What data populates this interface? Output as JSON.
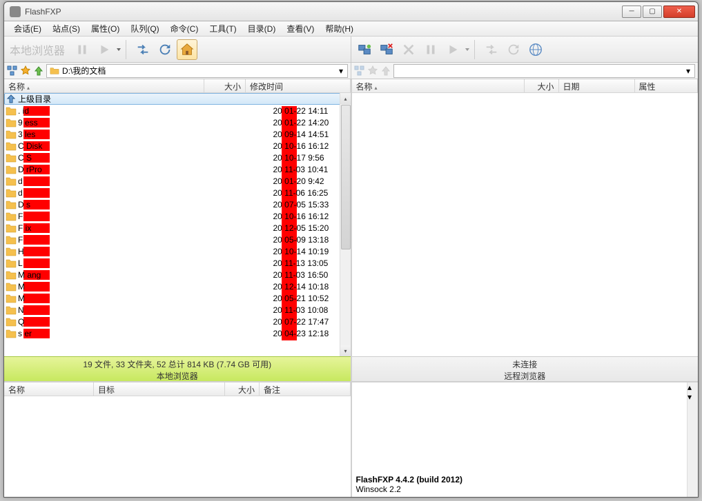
{
  "app_title": "FlashFXP",
  "menu": [
    "会话(E)",
    "站点(S)",
    "属性(O)",
    "队列(Q)",
    "命令(C)",
    "工具(T)",
    "目录(D)",
    "查看(V)",
    "帮助(H)"
  ],
  "local_toolbar_label": "本地浏览器",
  "local_path": "D:\\我的文档",
  "local_head": {
    "name": "名称",
    "size": "大小",
    "date": "修改时间"
  },
  "remote_head": {
    "name": "名称",
    "size": "大小",
    "date": "日期",
    "attr": "属性"
  },
  "parent_dir": "上级目录",
  "files": [
    {
      "n": ".         id",
      "d": "20   01-22 14:11"
    },
    {
      "n": "9         ess",
      "d": "20   01-22 14:20"
    },
    {
      "n": "3         les",
      "d": "20   09-14 14:51"
    },
    {
      "n": "C         Disk",
      "d": "20   10-16 16:12"
    },
    {
      "n": "C         S",
      "d": "20   10-17 9:56"
    },
    {
      "n": "D         rPro",
      "d": "20   11-03 10:41"
    },
    {
      "n": "d          ",
      "d": "20   01-20 9:42"
    },
    {
      "n": "d          ",
      "d": "20   11-06 16:25"
    },
    {
      "n": "D         s",
      "d": "20   07-05 15:33"
    },
    {
      "n": "F          ",
      "d": "20   10-16 16:12"
    },
    {
      "n": "F         ix",
      "d": "20   12-05 15:20"
    },
    {
      "n": "F          ",
      "d": "20   05-09 13:18"
    },
    {
      "n": "H          ",
      "d": "20   10-14 10:19"
    },
    {
      "n": "L          ",
      "d": "20   11-13 13:05"
    },
    {
      "n": "M         ang",
      "d": "20   11-03 16:50"
    },
    {
      "n": "M          ",
      "d": "20   12-14 10:18"
    },
    {
      "n": "M          ",
      "d": "20   05-21 10:52"
    },
    {
      "n": "N          ",
      "d": "20   11-03 10:08"
    },
    {
      "n": "Q          ",
      "d": "20   07-22 17:47"
    },
    {
      "n": "s         er",
      "d": "20   04-23 12:18"
    }
  ],
  "local_status1": "19 文件, 33 文件夹, 52 总计 814 KB (7.74 GB 可用)",
  "local_status2": "本地浏览器",
  "remote_status1": "未连接",
  "remote_status2": "远程浏览器",
  "queue_head": {
    "name": "名称",
    "target": "目标",
    "size": "大小",
    "note": "备注"
  },
  "log_line1": "FlashFXP 4.4.2 (build 2012)",
  "log_line2": "Winsock 2.2"
}
